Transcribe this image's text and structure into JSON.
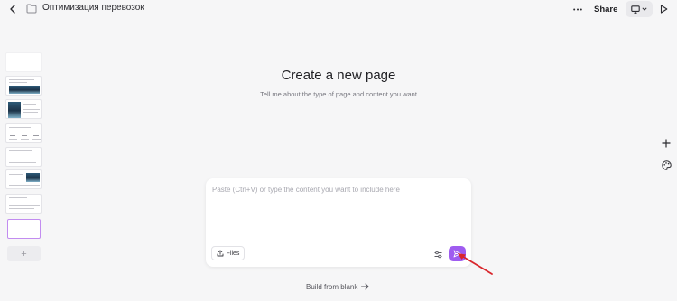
{
  "header": {
    "title": "Оптимизация перевозок",
    "share_label": "Share"
  },
  "main": {
    "heading": "Create a new page",
    "subheading": "Tell me about the type of page and content you want"
  },
  "composer": {
    "placeholder": "Paste (Ctrl+V) or type the content you want to include here",
    "files_label": "Files"
  },
  "footer": {
    "build_blank_label": "Build from blank"
  },
  "sidebar": {
    "add_label": "+"
  },
  "colors": {
    "accent": "#9f5cf0",
    "annotation_arrow": "#d9262c",
    "active_thumb_border": "#c28cf0"
  },
  "icons": {
    "back": "chevron-left-icon",
    "folder": "folder-icon",
    "more": "more-horizontal-icon",
    "device": "monitor-icon",
    "present": "play-icon",
    "add": "plus-icon",
    "theme": "palette-icon",
    "upload": "upload-icon",
    "settings": "sliders-icon",
    "send": "send-icon",
    "arrow_right": "arrow-right-icon"
  }
}
